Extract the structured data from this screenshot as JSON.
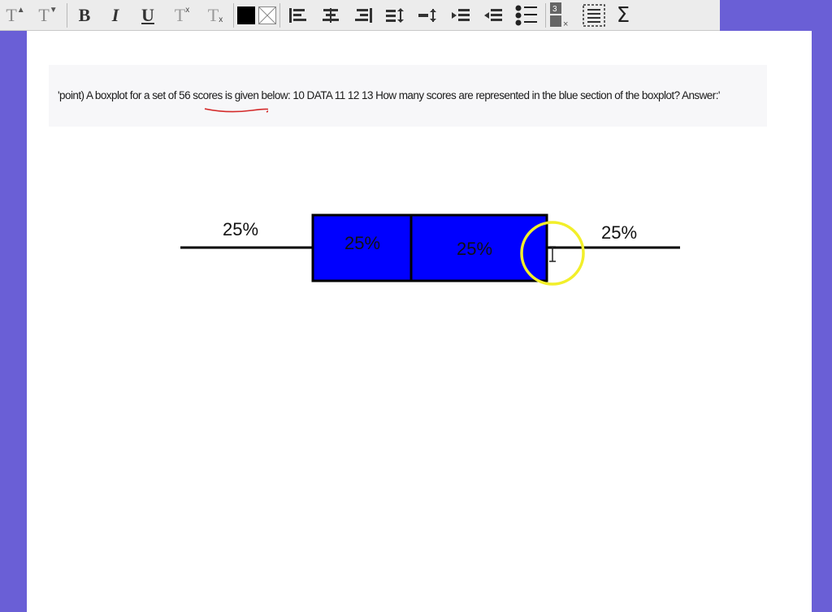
{
  "toolbar": {
    "items": [
      {
        "name": "font-size-increase-button",
        "label": "T"
      },
      {
        "name": "font-size-decrease-button",
        "label": "T"
      },
      {
        "name": "bold-button",
        "label": "B"
      },
      {
        "name": "italic-button",
        "label": "I"
      },
      {
        "name": "underline-button",
        "label": "U"
      },
      {
        "name": "superscript-button",
        "label": "T"
      },
      {
        "name": "subscript-button",
        "label": "T"
      }
    ],
    "icons": [
      "fill-color-icon",
      "no-fill-icon",
      "align-left-icon",
      "align-center-icon",
      "align-right-icon",
      "line-spacing-icon",
      "paragraph-spacing-icon",
      "indent-icon",
      "outdent-icon",
      "bullet-list-icon",
      "fraction-icon",
      "table-icon",
      "sigma-icon"
    ],
    "sigma_label": "Σ"
  },
  "question": {
    "prefix": "'point) A boxplot for a set of ",
    "highlight": "56 scores",
    "suffix": " is given below: 10 DATA 11 12 13 How many scores are represented in the blue section of the boxplot? Answer:'"
  },
  "boxplot": {
    "labels": [
      "25%",
      "25%",
      "25%",
      "25%"
    ],
    "box_color": "#0000ff",
    "highlight_circle_color": "#f2ef2a"
  },
  "colors": {
    "background": "#6a5fd6",
    "canvas": "#ffffff",
    "squiggle": "#d42a2a"
  }
}
